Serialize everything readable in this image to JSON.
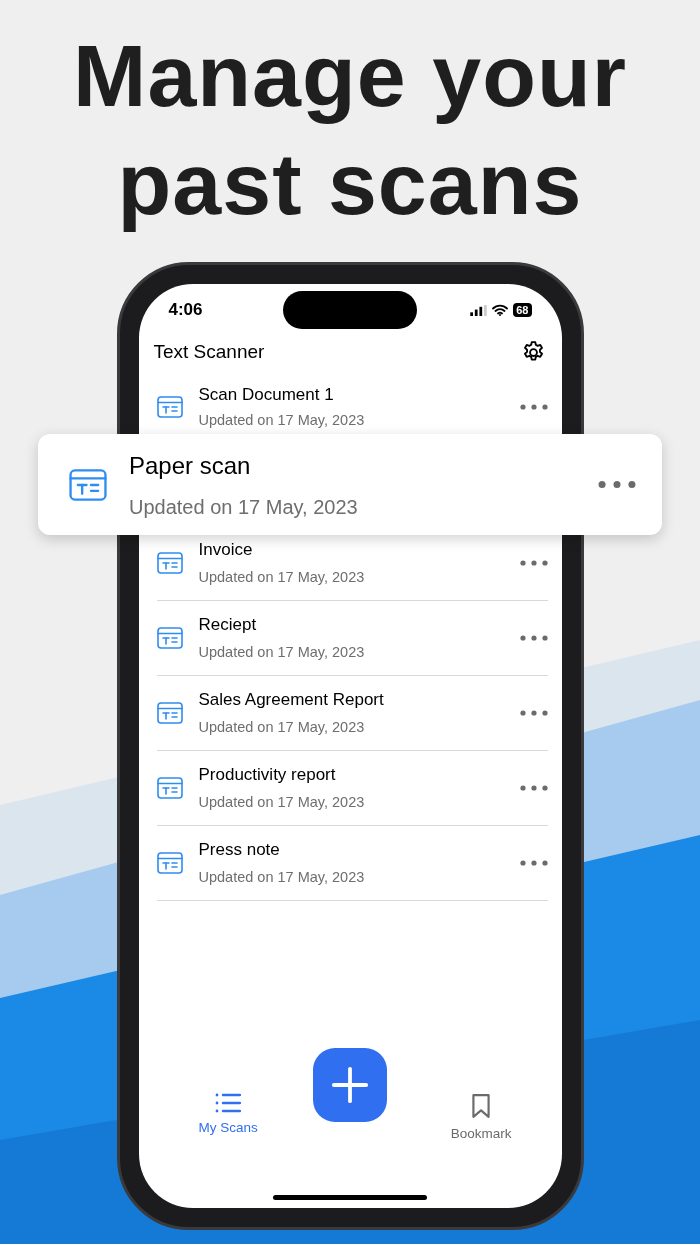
{
  "headline": "Manage your past scans",
  "status_bar": {
    "time": "4:06",
    "battery": "68"
  },
  "app_bar": {
    "title": "Text Scanner"
  },
  "scans": [
    {
      "title": "Scan Document 1",
      "subtitle": "Updated on 17 May, 2023"
    },
    {
      "title": "Invoice",
      "subtitle": "Updated on 17 May, 2023"
    },
    {
      "title": "Reciept",
      "subtitle": "Updated on 17 May, 2023"
    },
    {
      "title": "Sales Agreement Report",
      "subtitle": "Updated on 17 May, 2023"
    },
    {
      "title": "Productivity report",
      "subtitle": "Updated on 17 May, 2023"
    },
    {
      "title": "Press note",
      "subtitle": "Updated on 17 May, 2023"
    }
  ],
  "highlighted_scan": {
    "title": "Paper scan",
    "subtitle": "Updated on 17 May, 2023"
  },
  "tabs": [
    {
      "label": "My Scans",
      "selected": true
    },
    {
      "label": "Bookmark",
      "selected": false
    }
  ]
}
